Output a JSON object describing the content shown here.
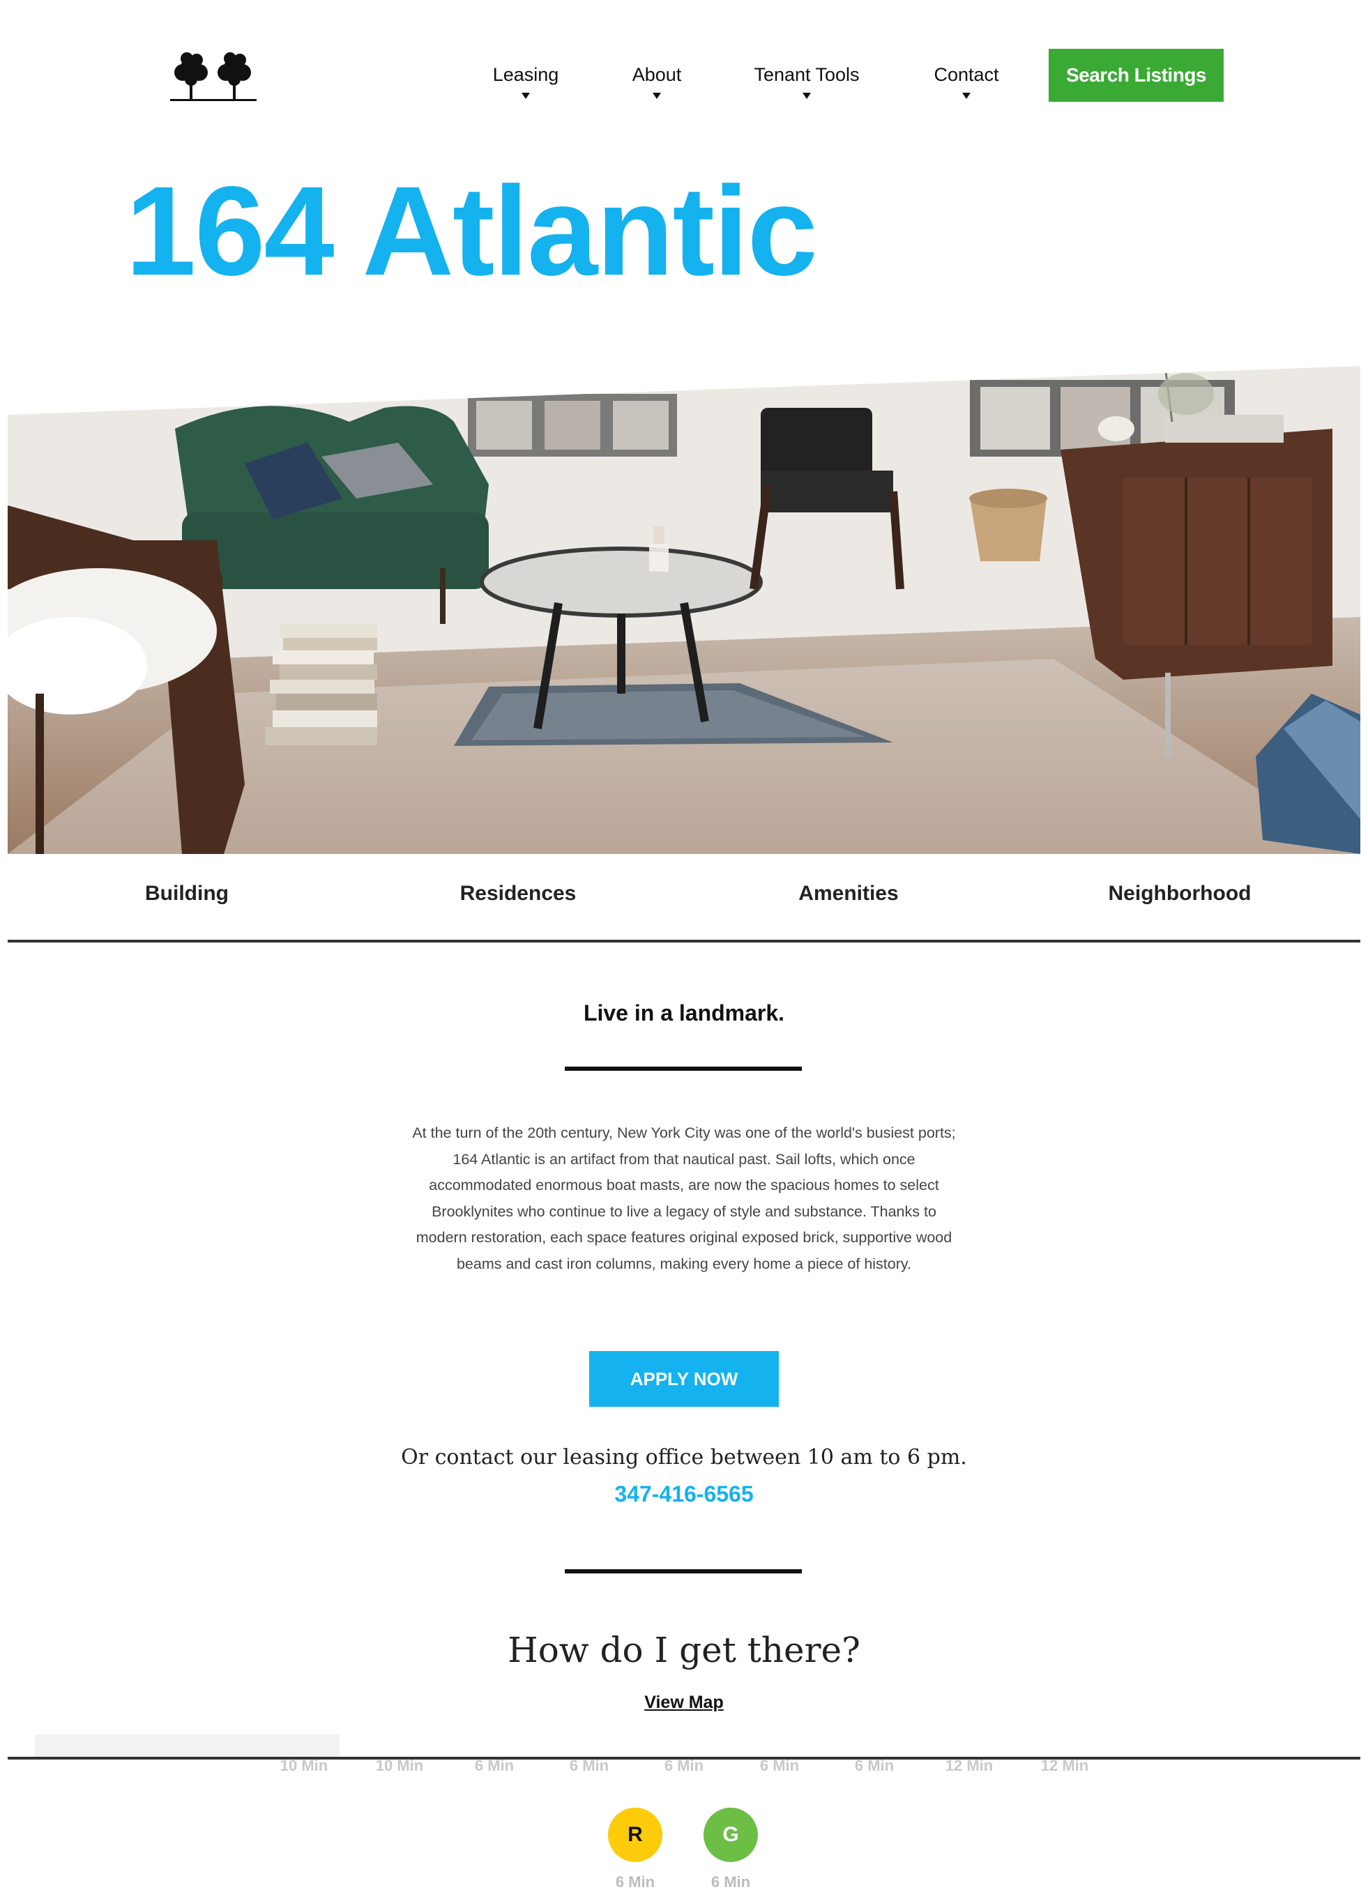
{
  "header": {
    "nav": [
      {
        "label": "Leasing"
      },
      {
        "label": "About"
      },
      {
        "label": "Tenant Tools"
      },
      {
        "label": "Contact"
      }
    ],
    "search_label": "Search Listings"
  },
  "page_title": "164 Atlantic",
  "tabs": [
    {
      "label": "Building"
    },
    {
      "label": "Residences"
    },
    {
      "label": "Amenities"
    },
    {
      "label": "Neighborhood"
    }
  ],
  "intro": {
    "heading": "Live in a landmark.",
    "body": "At the turn of the 20th century, New York City was one of the world's busiest ports; 164 Atlantic is an artifact from that nautical past. Sail lofts, which once accommodated enormous boat masts, are now the spacious homes to select Brooklynites who continue to live a legacy of style and substance. Thanks to modern restoration, each space features original exposed brick, supportive wood beams and cast iron columns, making every home a piece of history.",
    "apply_label": "APPLY NOW",
    "contact_text": "Or contact our leasing office between 10 am to 6 pm.",
    "phone": "347-416-6565"
  },
  "directions": {
    "heading": "How do I get there?",
    "view_map_label": "View Map",
    "faded_times": [
      "10 Min",
      "10 Min",
      "6 Min",
      "6 Min",
      "6 Min",
      "6 Min",
      "6 Min",
      "12 Min",
      "12 Min"
    ],
    "lines": [
      {
        "letter": "R",
        "time": "6 Min",
        "color": "#fccc0a"
      },
      {
        "letter": "G",
        "time": "6 Min",
        "color": "#6cbe45"
      }
    ]
  },
  "colors": {
    "accent": "#14b2ee",
    "search_button": "#3aaa35"
  }
}
